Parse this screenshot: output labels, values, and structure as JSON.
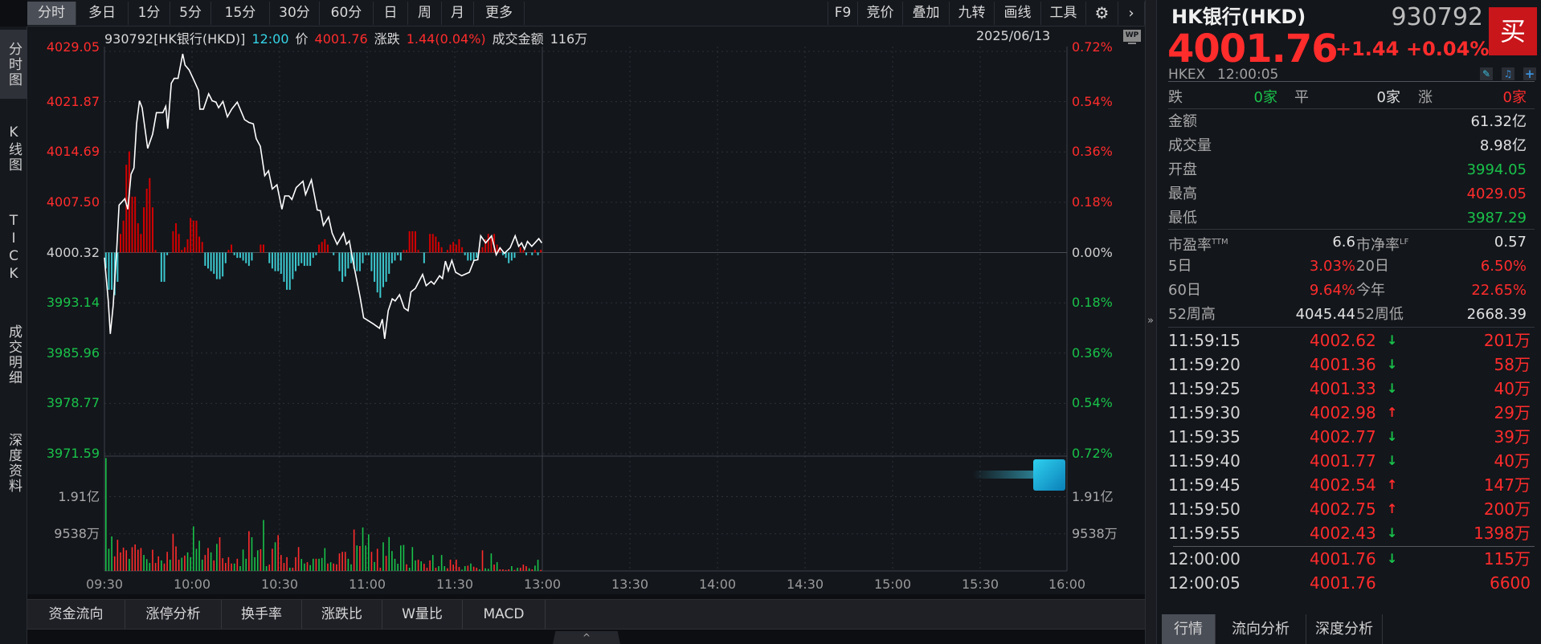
{
  "toolbar": {
    "tabs": [
      "分时",
      "多日",
      "1分",
      "5分",
      "15分",
      "30分",
      "60分",
      "日",
      "周",
      "月",
      "更多"
    ],
    "right": [
      "F9",
      "竞价",
      "叠加",
      "九转",
      "画线",
      "工具"
    ]
  },
  "leftnav": [
    "分时图",
    "K线图",
    "TICK",
    "成交明细",
    "深度资料"
  ],
  "info": {
    "code_name": "930792[HK银行(HKD)]",
    "time": "12:00",
    "price_label": "价",
    "price": "4001.76",
    "change_label": "涨跌",
    "change": "1.44(0.04%)",
    "amount_label": "成交金额",
    "amount": "116万",
    "date": "2025/06/13",
    "wp": "WP"
  },
  "bottom_tabs": [
    "资金流向",
    "涨停分析",
    "换手率",
    "涨跌比",
    "W量比",
    "MACD"
  ],
  "collapse": "^",
  "chart_data": {
    "type": "line",
    "title": "930792[HK银行(HKD)] 分时",
    "prev_close": 4000.32,
    "ylim": [
      3971.59,
      4029.05
    ],
    "left_ticks": [
      "4029.05",
      "4021.87",
      "4014.69",
      "4007.50",
      "4000.32",
      "3993.14",
      "3985.96",
      "3978.77",
      "3971.59"
    ],
    "right_ticks": [
      "0.72%",
      "0.54%",
      "0.36%",
      "0.18%",
      "0.00%",
      "0.18%",
      "0.36%",
      "0.54%",
      "0.72%"
    ],
    "x_ticks": [
      "09:30",
      "10:00",
      "10:30",
      "11:00",
      "11:30",
      "13:00",
      "13:30",
      "14:00",
      "14:30",
      "15:00",
      "15:30",
      "16:00"
    ],
    "vol_ticks": [
      "1.91亿",
      "9538万"
    ],
    "vol_tick_values": [
      19076,
      9538
    ],
    "price_series": [
      [
        0,
        3999.6
      ],
      [
        1.3,
        3993.5
      ],
      [
        2,
        3988.7
      ],
      [
        3,
        3992.8
      ],
      [
        4.2,
        4000.8
      ],
      [
        5,
        4007.1
      ],
      [
        7,
        4008.0
      ],
      [
        8,
        4006.5
      ],
      [
        9.1,
        4011.5
      ],
      [
        10.1,
        4012.4
      ],
      [
        11,
        4018.7
      ],
      [
        12,
        4022.0
      ],
      [
        12.9,
        4021.0
      ],
      [
        14.8,
        4015.2
      ],
      [
        16.5,
        4017.2
      ],
      [
        17.8,
        4020.3
      ],
      [
        20,
        4020.3
      ],
      [
        21,
        4021.2
      ],
      [
        21.7,
        4018.0
      ],
      [
        22.9,
        4024.5
      ],
      [
        23.9,
        4025.2
      ],
      [
        25.2,
        4025.2
      ],
      [
        26.8,
        4028.7
      ],
      [
        27.6,
        4027.1
      ],
      [
        29,
        4026.4
      ],
      [
        30.8,
        4024.8
      ],
      [
        32.2,
        4023.5
      ],
      [
        32.7,
        4020.8
      ],
      [
        33.9,
        4020.8
      ],
      [
        35.7,
        4023.0
      ],
      [
        36.9,
        4022.0
      ],
      [
        38.2,
        4021.8
      ],
      [
        39.1,
        4021.0
      ],
      [
        40.6,
        4021.9
      ],
      [
        42.1,
        4019.7
      ],
      [
        43.6,
        4020.8
      ],
      [
        45.5,
        4021.8
      ],
      [
        48,
        4019.3
      ],
      [
        49.5,
        4018.9
      ],
      [
        51,
        4018.7
      ],
      [
        52,
        4016.6
      ],
      [
        53.4,
        4015.5
      ],
      [
        54.9,
        4011.3
      ],
      [
        56.2,
        4012.0
      ],
      [
        57.5,
        4009.4
      ],
      [
        59.1,
        4010.0
      ],
      [
        60.8,
        4006.5
      ],
      [
        61.8,
        4008.4
      ],
      [
        63.2,
        4008.4
      ],
      [
        64.2,
        4007.9
      ],
      [
        65.7,
        4009.6
      ],
      [
        68,
        4010.5
      ],
      [
        68.9,
        4008.6
      ],
      [
        70.9,
        4010.7
      ],
      [
        72.9,
        4006.4
      ],
      [
        74,
        4006.3
      ],
      [
        75,
        4004.2
      ],
      [
        76.8,
        4005.4
      ],
      [
        78,
        4003.1
      ],
      [
        79.7,
        4001.5
      ],
      [
        81.9,
        4003.1
      ],
      [
        82.9,
        4001.5
      ],
      [
        83.9,
        4002.0
      ],
      [
        84.9,
        3999.6
      ],
      [
        87.6,
        3993.9
      ],
      [
        88.8,
        3991.0
      ],
      [
        90.3,
        3990.6
      ],
      [
        92.2,
        3990.1
      ],
      [
        94.2,
        3989.5
      ],
      [
        95.2,
        3990.8
      ],
      [
        96,
        3988.0
      ],
      [
        97.2,
        3992.0
      ],
      [
        98.6,
        3993.7
      ],
      [
        99.6,
        3993.4
      ],
      [
        101.1,
        3994.3
      ],
      [
        102.7,
        3992.4
      ],
      [
        104,
        3992.0
      ],
      [
        105,
        3994.7
      ],
      [
        106.5,
        3995.2
      ],
      [
        109,
        3997.2
      ],
      [
        110.2,
        3995.6
      ],
      [
        111.9,
        3996.2
      ],
      [
        112.9,
        3995.8
      ],
      [
        114.8,
        3997.0
      ],
      [
        115.8,
        3996.6
      ],
      [
        116.8,
        3999.1
      ],
      [
        117.8,
        3997.7
      ],
      [
        119,
        3999.2
      ],
      [
        120.3,
        3997.5
      ],
      [
        122.4,
        3997.0
      ],
      [
        125,
        3997.5
      ],
      [
        126.6,
        3999.2
      ],
      [
        127.9,
        3999.3
      ],
      [
        128.9,
        4002.7
      ],
      [
        130.6,
        4001.7
      ],
      [
        132.6,
        4002.7
      ],
      [
        134.2,
        4000.0
      ],
      [
        135.5,
        4001.0
      ],
      [
        137,
        4000.2
      ],
      [
        139,
        4001.0
      ],
      [
        140.7,
        4002.7
      ],
      [
        141.9,
        4001.2
      ],
      [
        142.9,
        4001.7
      ],
      [
        143.9,
        4000.8
      ],
      [
        144.9,
        4001.9
      ],
      [
        146.4,
        4001.2
      ],
      [
        148.8,
        4002.3
      ],
      [
        149.8,
        4001.7
      ]
    ],
    "flow_bars": [
      -6,
      -14,
      -14,
      -16,
      -11,
      7,
      12,
      33,
      38,
      21,
      21,
      11,
      7,
      17,
      24,
      28,
      17,
      1,
      0,
      -11,
      -11,
      -1,
      0,
      8,
      11,
      7,
      1,
      2,
      5,
      13,
      12,
      12,
      6,
      4,
      -5,
      -6,
      -7,
      -8,
      -10,
      -10,
      -9,
      -4,
      1,
      3,
      -1,
      -2,
      -2,
      -3,
      -4,
      -5,
      -3,
      0,
      0,
      3,
      3,
      0,
      -4,
      -6,
      -7,
      -7,
      -8,
      -11,
      -14,
      -14,
      -10,
      -7,
      -5,
      -4,
      -5,
      -5,
      -5,
      -2,
      -1,
      3,
      4,
      5,
      3,
      0,
      -1,
      0,
      -7,
      -11,
      -9,
      -6,
      -4,
      -6,
      -7,
      -7,
      -4,
      -1,
      -1,
      -7,
      -11,
      -15,
      -17,
      -13,
      -11,
      -8,
      -4,
      -3,
      -1,
      -3,
      1,
      1,
      8,
      8,
      8,
      1,
      0,
      -4,
      0,
      7,
      7,
      6,
      4,
      2,
      0,
      1,
      3,
      4,
      3,
      5,
      2,
      -1,
      -3,
      -3,
      -3,
      -2,
      1,
      2,
      5,
      7,
      6,
      7,
      3,
      2,
      -1,
      -2,
      -4,
      -3,
      -2,
      0,
      2,
      1,
      -1,
      0,
      -1,
      1,
      -1,
      1
    ],
    "volume_wan": [
      29000,
      5700,
      8850,
      3750,
      8000,
      4770,
      6000,
      5300,
      3100,
      6100,
      6800,
      5450,
      5900,
      4100,
      3050,
      2050,
      5450,
      2050,
      3750,
      2700,
      1900,
      4900,
      2900,
      9540,
      6300,
      2900,
      3400,
      3950,
      4770,
      3540,
      11450,
      5700,
      7770,
      2900,
      4100,
      5900,
      4770,
      2700,
      6950,
      8650,
      3270,
      2050,
      3540,
      1900,
      1900,
      3130,
      1230,
      5500,
      3130,
      10200,
      8650,
      3540,
      5300,
      5600,
      13080,
      1230,
      1640,
      5700,
      7360,
      9200,
      4100,
      2050,
      3540,
      820,
      820,
      3540,
      6130,
      3070,
      1900,
      2250,
      1500,
      3130,
      3130,
      3130,
      3340,
      5860,
      1900,
      2250,
      1900,
      1700,
      4500,
      4900,
      4900,
      3130,
      1700,
      10630,
      6540,
      6400,
      11170,
      6540,
      9400,
      4900,
      2300,
      5700,
      820,
      7360,
      3880,
      8720,
      5100,
      3130,
      1840,
      6540,
      6680,
      1700,
      820,
      6130,
      2700,
      2900,
      2450,
      1840,
      820,
      2700,
      4100,
      820,
      1230,
      4100,
      1230,
      680,
      2900,
      1640,
      2900,
      1020,
      340,
      1230,
      1360,
      1900,
      1090,
      820,
      410,
      5300,
      680,
      550,
      4500,
      1640,
      2250,
      410,
      410,
      270,
      410,
      1230,
      270,
      820,
      820,
      1640,
      1230,
      680,
      410,
      1360,
      2860,
      270
    ],
    "volume_dir": "ggg rrrrr grrrr ggg rrr g rr g r rr g r g ggggg rr g r g rrrrr g r g gg r gg g r gg r r g rr rr g r rr g g r gg r gg g r g rr rrr gg r g r gg g r g rr g r ggggg g r g g g r g rr r g r g g g r rrrr g g r g rr g r g g g r g rrrr g r g rr r g r g g r g r r g rr g r r r g",
    "colors": {
      "up": "#ff2c2c",
      "down": "#19c24a",
      "flow_up": "#d40000",
      "flow_down": "#3cc8cf",
      "line": "#ffffff"
    }
  },
  "quote": {
    "name": "HK银行(HKD)",
    "code": "930792",
    "price": "4001.76",
    "change": "+1.44",
    "pct": "+0.04%",
    "buy": "买",
    "exchange": "HKEX",
    "time": "12:00:05",
    "breadth": {
      "down_label": "跌",
      "down": "0家",
      "flat_label": "平",
      "flat": "0家",
      "up_label": "涨",
      "up": "0家"
    },
    "stats": [
      {
        "label": "金额",
        "value": "61.32亿",
        "color": "#e0e0e0"
      },
      {
        "label": "成交量",
        "value": "8.98亿",
        "color": "#e0e0e0"
      },
      {
        "label": "开盘",
        "value": "3994.05",
        "color": "#19c24a"
      },
      {
        "label": "最高",
        "value": "4029.05",
        "color": "#ff2c2c"
      },
      {
        "label": "最低",
        "value": "3987.29",
        "color": "#19c24a"
      }
    ],
    "ratios": [
      {
        "l1": "市盈率",
        "s1": "TTM",
        "v1": "6.6",
        "c1": "#e0e0e0",
        "l2": "市净率",
        "s2": "LF",
        "v2": "0.57",
        "c2": "#e0e0e0"
      },
      {
        "l1": "5日",
        "s1": "",
        "v1": "3.03%",
        "c1": "#ff2c2c",
        "l2": "20日",
        "s2": "",
        "v2": "6.50%",
        "c2": "#ff2c2c"
      },
      {
        "l1": "60日",
        "s1": "",
        "v1": "9.64%",
        "c1": "#ff2c2c",
        "l2": "今年",
        "s2": "",
        "v2": "22.65%",
        "c2": "#ff2c2c"
      },
      {
        "l1": "52周高",
        "s1": "",
        "v1": "4045.44",
        "c1": "#e0e0e0",
        "l2": "52周低",
        "s2": "",
        "v2": "2668.39",
        "c2": "#e0e0e0"
      }
    ],
    "trades": [
      {
        "t": "11:59:15",
        "p": "4002.62",
        "d": "down",
        "v": "201万"
      },
      {
        "t": "11:59:20",
        "p": "4001.36",
        "d": "down",
        "v": "58万"
      },
      {
        "t": "11:59:25",
        "p": "4001.33",
        "d": "down",
        "v": "40万"
      },
      {
        "t": "11:59:30",
        "p": "4002.98",
        "d": "up",
        "v": "29万"
      },
      {
        "t": "11:59:35",
        "p": "4002.77",
        "d": "down",
        "v": "39万"
      },
      {
        "t": "11:59:40",
        "p": "4001.77",
        "d": "down",
        "v": "40万"
      },
      {
        "t": "11:59:45",
        "p": "4002.54",
        "d": "up",
        "v": "147万"
      },
      {
        "t": "11:59:50",
        "p": "4002.75",
        "d": "up",
        "v": "200万"
      },
      {
        "t": "11:59:55",
        "p": "4002.43",
        "d": "down",
        "v": "1398万"
      },
      {
        "t": "12:00:00",
        "p": "4001.76",
        "d": "down",
        "v": "115万"
      },
      {
        "t": "12:00:05",
        "p": "4001.76",
        "d": "",
        "v": "6600"
      }
    ],
    "tabs": [
      "行情",
      "流向分析",
      "深度分析"
    ]
  },
  "side_toggle": "»"
}
